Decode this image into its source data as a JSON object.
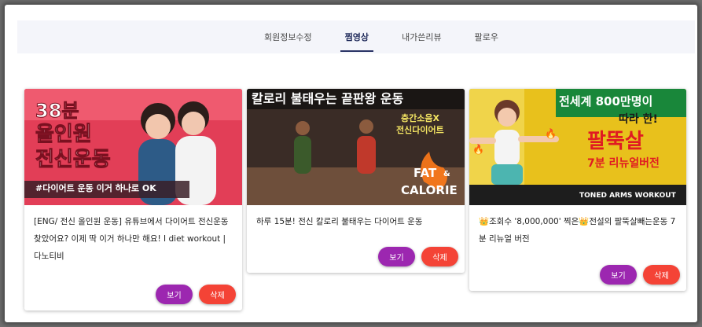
{
  "tabs": [
    {
      "label": "회원정보수정",
      "active": false
    },
    {
      "label": "찜영상",
      "active": true
    },
    {
      "label": "내가쓴리뷰",
      "active": false
    },
    {
      "label": "팔로우",
      "active": false
    }
  ],
  "cards": [
    {
      "thumb_lines": [
        "38분",
        "올인원",
        "전신운동"
      ],
      "thumb_banner": "#다이어트 운동 이거 하나로 OK",
      "title": "[ENG/ 전신 올인원 운동] 유튜브에서 다이어트 전신운동 찾았어요? 이제 딱 이거 하나만 해요! I diet workout | 다노티비",
      "view_label": "보기",
      "delete_label": "삭제"
    },
    {
      "thumb_top": "칼로리 불태우는 끝판왕 운동",
      "thumb_sub1": "층간소음X",
      "thumb_sub2": "전신다이어트",
      "thumb_fat": "FAT",
      "thumb_amp": "&",
      "thumb_calorie": "CALORIE",
      "title": "하루 15분! 전신 칼로리 불태우는 다이어트 운동",
      "view_label": "보기",
      "delete_label": "삭제"
    },
    {
      "thumb_line1": "전세계 800만명이",
      "thumb_line2": "따라 한!",
      "thumb_line3": "팔뚝살",
      "thumb_line4": "7분 리뉴얼버전",
      "thumb_line5": "TONED ARMS WORKOUT",
      "title": "👑조회수 '8,000,000' 찍은👑전설의 팔뚝살빼는운동 7분 리뉴얼 버전",
      "view_label": "보기",
      "delete_label": "삭제"
    }
  ],
  "colors": {
    "accent_view": "#9c27b0",
    "accent_delete": "#f44336",
    "tab_active": "#1f2a5a",
    "tabbar_bg": "#f4f5fa"
  }
}
